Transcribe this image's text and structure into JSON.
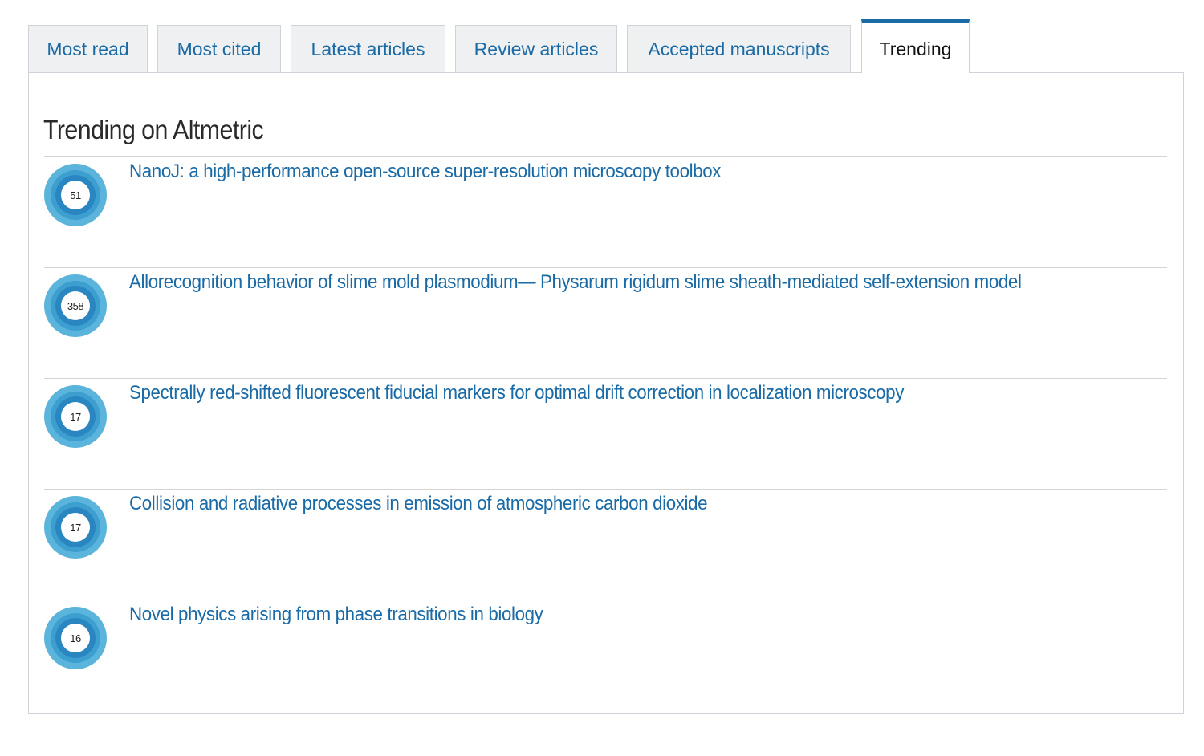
{
  "tabs": [
    {
      "label": "Most read",
      "active": false
    },
    {
      "label": "Most cited",
      "active": false
    },
    {
      "label": "Latest articles",
      "active": false
    },
    {
      "label": "Review articles",
      "active": false
    },
    {
      "label": "Accepted manuscripts",
      "active": false
    },
    {
      "label": "Trending",
      "active": true
    }
  ],
  "panel": {
    "title": "Trending on Altmetric",
    "articles": [
      {
        "score": "51",
        "title": "NanoJ: a high-performance open-source super-resolution microscopy toolbox",
        "badge_icon": "altmetric-donut-icon"
      },
      {
        "score": "358",
        "title": "Allorecognition behavior of slime mold plasmodium— Physarum rigidum slime sheath-mediated self-extension model",
        "badge_icon": "altmetric-donut-icon"
      },
      {
        "score": "17",
        "title": "Spectrally red-shifted fluorescent fiducial markers for optimal drift correction in localization microscopy",
        "badge_icon": "altmetric-donut-icon"
      },
      {
        "score": "17",
        "title": "Collision and radiative processes in emission of atmospheric carbon dioxide",
        "badge_icon": "altmetric-donut-icon"
      },
      {
        "score": "16",
        "title": "Novel physics arising from phase transitions in biology",
        "badge_icon": "altmetric-donut-icon"
      }
    ]
  },
  "colors": {
    "link": "#1a6aa6",
    "tab_accent": "#1a6aa6",
    "donut_outer": "#5ab4dc",
    "donut_inner": "#2a86c0"
  }
}
